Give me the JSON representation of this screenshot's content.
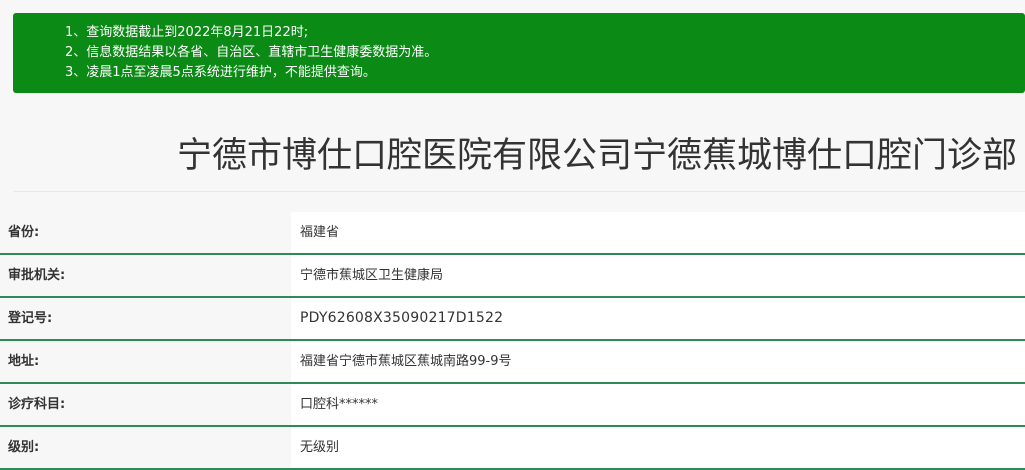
{
  "notice": {
    "lines": [
      "1、查询数据截止到2022年8月21日22时;",
      "2、信息数据结果以各省、自治区、直辖市卫生健康委数据为准。",
      "3、凌晨1点至凌晨5点系统进行维护，不能提供查询。"
    ]
  },
  "title": "宁德市博仕口腔医院有限公司宁德蕉城博仕口腔门诊部",
  "rows": [
    {
      "label": "省份:",
      "value": "福建省"
    },
    {
      "label": "审批机关:",
      "value": "宁德市蕉城区卫生健康局"
    },
    {
      "label": "登记号:",
      "value": "PDY62608X35090217D1522"
    },
    {
      "label": "地址:",
      "value": "福建省宁德市蕉城区蕉城南路99-9号"
    },
    {
      "label": "诊疗科目:",
      "value": "口腔科******"
    },
    {
      "label": "级别:",
      "value": "无级别"
    }
  ],
  "colors": {
    "notice_bg": "#0b8a15",
    "row_border": "#2e8b57"
  }
}
